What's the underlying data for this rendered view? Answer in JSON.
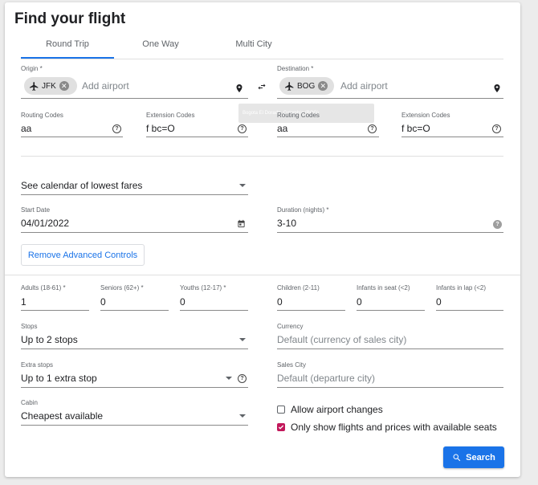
{
  "title": "Find your flight",
  "tabs": [
    {
      "label": "Round Trip",
      "active": true
    },
    {
      "label": "One Way",
      "active": false
    },
    {
      "label": "Multi City",
      "active": false
    }
  ],
  "origin": {
    "label": "Origin *",
    "chip": "JFK",
    "placeholder": "Add airport"
  },
  "destination": {
    "label": "Destination *",
    "chip": "BOG",
    "placeholder": "Add airport"
  },
  "tooltip": "Bogota El Dorado, Colombia (BOG)",
  "routing": {
    "origin_routing_label": "Routing Codes",
    "origin_routing_value": "aa",
    "origin_ext_label": "Extension Codes",
    "origin_ext_value": "f bc=O",
    "dest_routing_label": "Routing Codes",
    "dest_routing_value": "aa",
    "dest_ext_label": "Extension Codes",
    "dest_ext_value": "f bc=O"
  },
  "calendar_select": "See calendar of lowest fares",
  "start_date": {
    "label": "Start Date",
    "value": "04/01/2022"
  },
  "duration": {
    "label": "Duration (nights) *",
    "value": "3-10"
  },
  "advanced_button": "Remove Advanced Controls",
  "passengers": {
    "adults": {
      "label": "Adults (18-61) *",
      "value": "1"
    },
    "seniors": {
      "label": "Seniors (62+) *",
      "value": "0"
    },
    "youths": {
      "label": "Youths (12-17) *",
      "value": "0"
    },
    "children": {
      "label": "Children (2-11)",
      "value": "0"
    },
    "infants_seat": {
      "label": "Infants in seat (<2)",
      "value": "0"
    },
    "infants_lap": {
      "label": "Infants in lap (<2)",
      "value": "0"
    }
  },
  "stops": {
    "label": "Stops",
    "value": "Up to 2 stops"
  },
  "currency": {
    "label": "Currency",
    "placeholder": "Default (currency of sales city)"
  },
  "extra_stops": {
    "label": "Extra stops",
    "value": "Up to 1 extra stop"
  },
  "sales_city": {
    "label": "Sales City",
    "placeholder": "Default (departure city)"
  },
  "cabin": {
    "label": "Cabin",
    "value": "Cheapest available"
  },
  "checkboxes": {
    "allow_changes": {
      "label": "Allow airport changes",
      "checked": false
    },
    "only_available": {
      "label": "Only show flights and prices with available seats",
      "checked": true
    }
  },
  "search_button": "Search",
  "colors": {
    "accent": "#1a73e8",
    "checkbox": "#c2185b"
  },
  "icons": [
    "airplane-icon",
    "clear-chip-icon",
    "location-pin-icon",
    "swap-icon",
    "help-icon",
    "calendar-icon",
    "dropdown-caret-icon",
    "search-icon"
  ]
}
